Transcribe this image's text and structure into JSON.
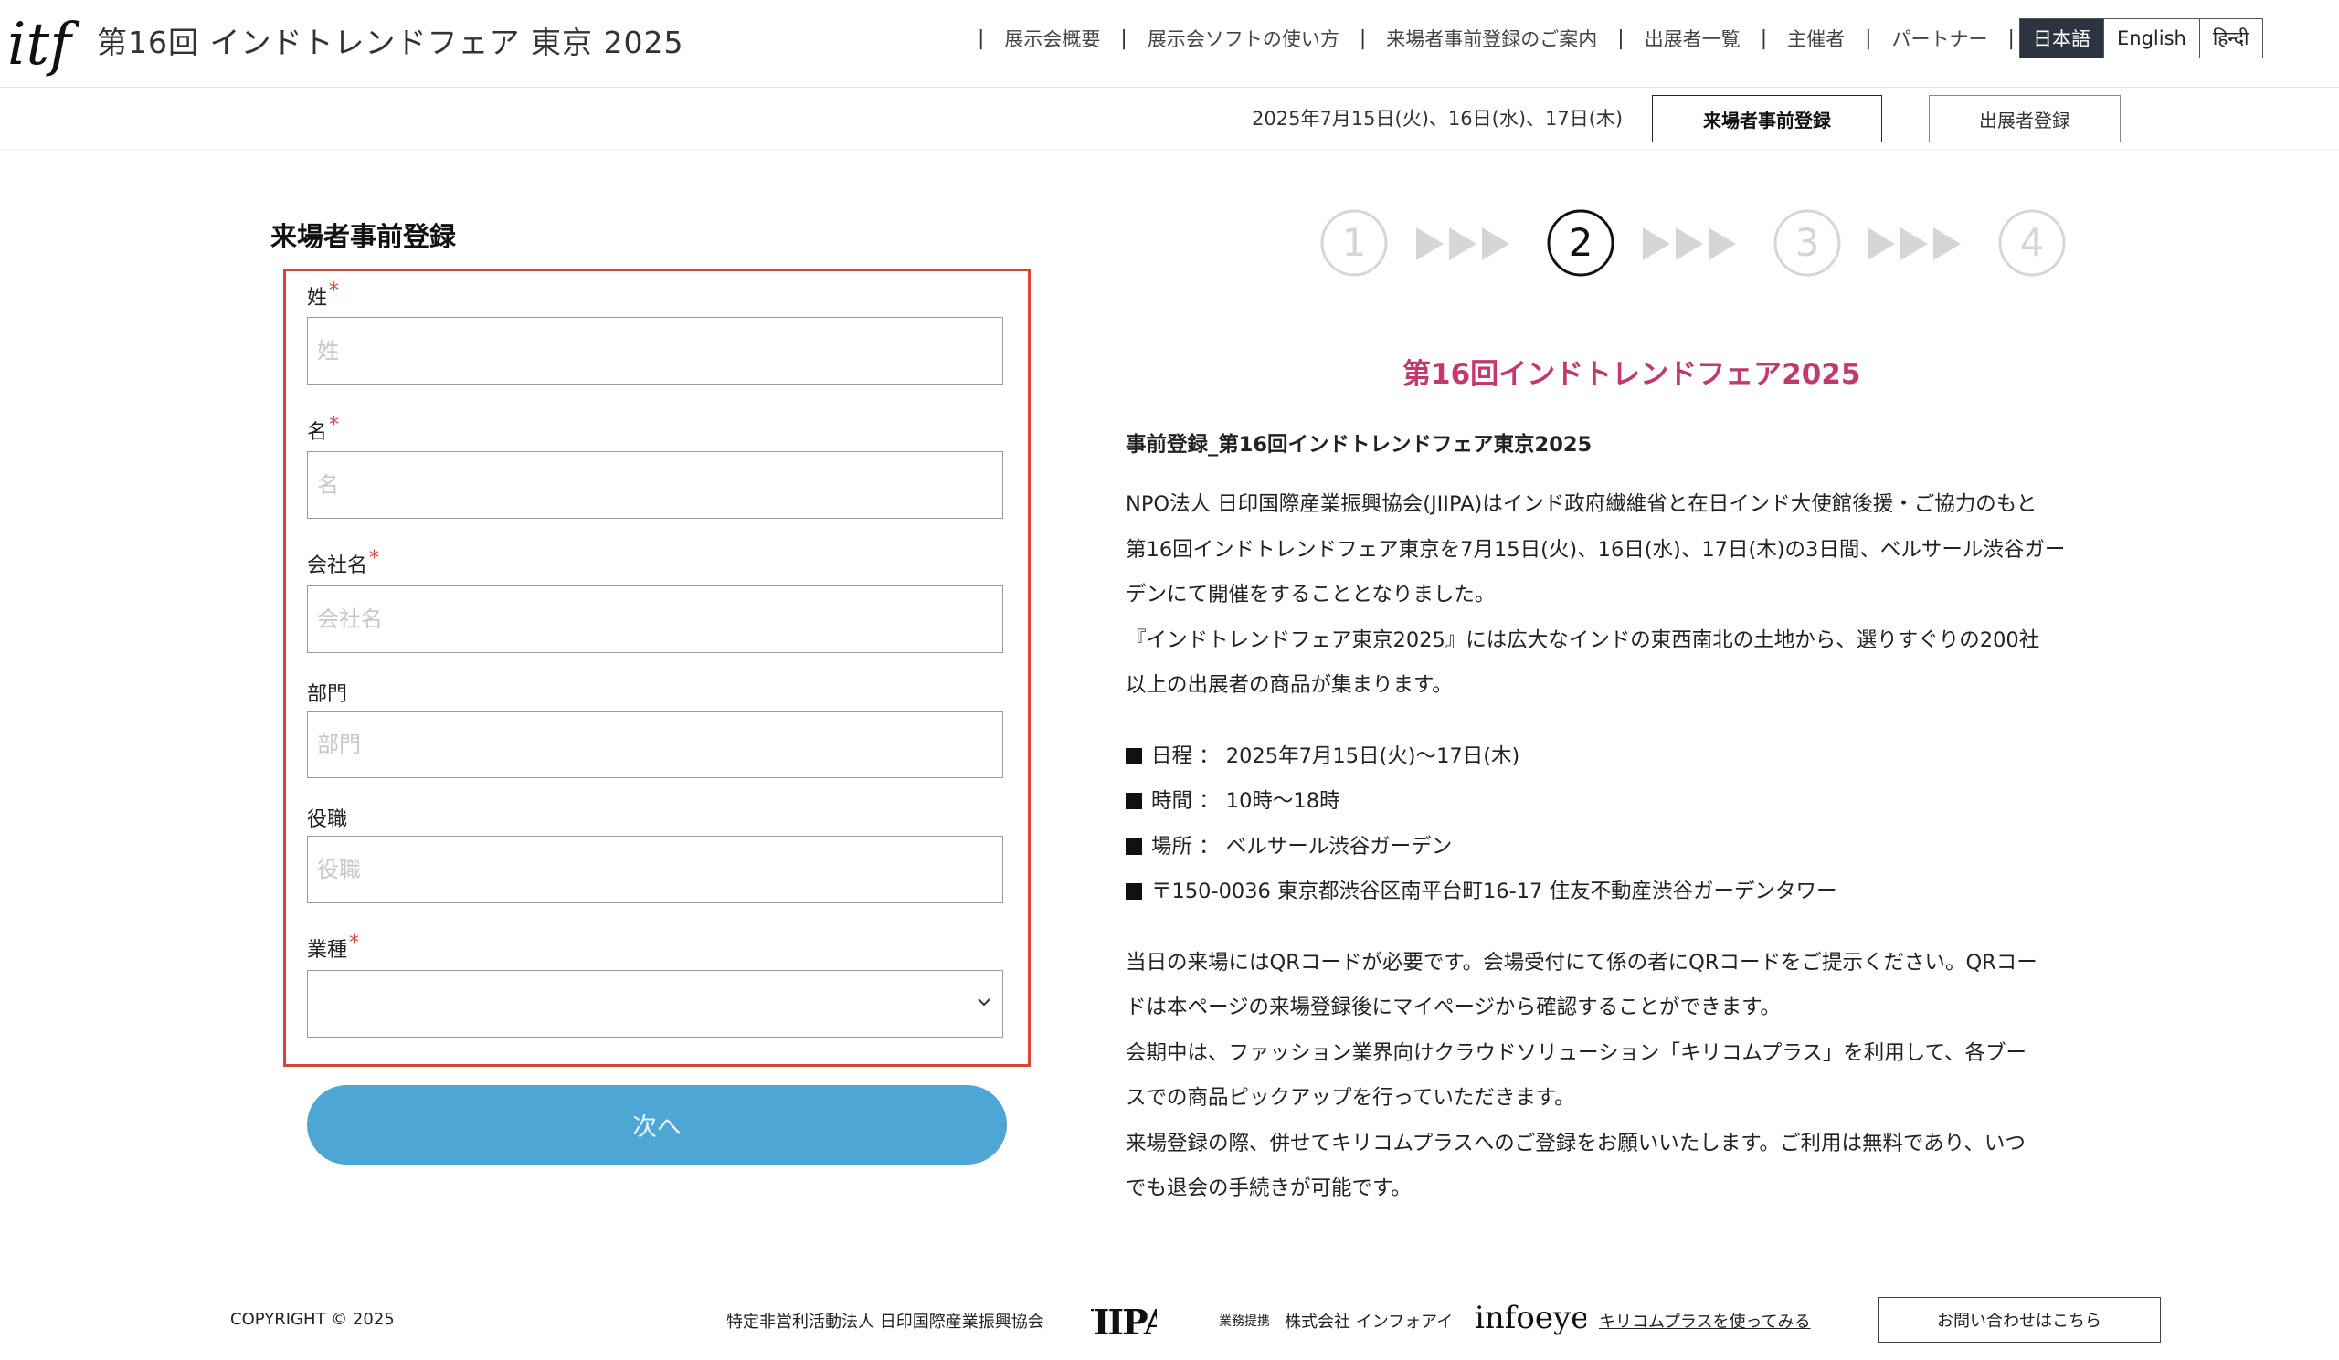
{
  "header": {
    "logo_text": "itf",
    "title": "第16回 インドトレンドフェア 東京 2025",
    "nav": [
      {
        "label": "展示会概要"
      },
      {
        "label": "展示会ソフトの使い方"
      },
      {
        "label": "来場者事前登録のご案内"
      },
      {
        "label": "出展者一覧"
      },
      {
        "label": "主催者"
      },
      {
        "label": "パートナー"
      }
    ],
    "languages": [
      {
        "label": "日本語",
        "active": true
      },
      {
        "label": "English",
        "active": false
      },
      {
        "label": "हिन्दी",
        "active": false
      }
    ]
  },
  "subbar": {
    "dates": "2025年7月15日(火)、16日(水)、17日(木)",
    "visitor_button": "来場者事前登録",
    "exhibitor_button": "出展者登録"
  },
  "form": {
    "title": "来場者事前登録",
    "required_mark": "*",
    "fields": [
      {
        "label": "姓",
        "placeholder": "姓",
        "required": true,
        "value": ""
      },
      {
        "label": "名",
        "placeholder": "名",
        "required": true,
        "value": ""
      },
      {
        "label": "会社名",
        "placeholder": "会社名",
        "required": true,
        "value": ""
      },
      {
        "label": "部門",
        "placeholder": "部門",
        "required": false,
        "value": ""
      },
      {
        "label": "役職",
        "placeholder": "役職",
        "required": false,
        "value": ""
      }
    ],
    "industry": {
      "label": "業種",
      "required": true,
      "selected": ""
    },
    "next_button": "次へ"
  },
  "steps": {
    "items": [
      "1",
      "2",
      "3",
      "4"
    ],
    "current": 2,
    "active_color": "#111111",
    "inactive_color": "#d6d6d6"
  },
  "info": {
    "heading": "第16回インドトレンドフェア2025",
    "heading_color": "#c23a6d",
    "lead": "事前登録_第16回インドトレンドフェア東京2025",
    "intro_lines": [
      "NPO法人 日印国際産業振興協会(JIIPA)はインド政府繊維省と在日インド大使館後援・ご協力のもと",
      "第16回インドトレンドフェア東京を7月15日(火)、16日(水)、17日(木)の3日間、ベルサール渋谷ガー",
      "デンにて開催をすることとなりました。",
      "『インドトレンドフェア東京2025』には広大なインドの東西南北の土地から、選りすぐりの200社",
      "以上の出展者の商品が集まります。"
    ],
    "bullets": [
      "日程 ： 2025年7月15日(火)〜17日(木)",
      "時間 ： 10時〜18時",
      "場所 ： ベルサール渋谷ガーデン",
      "〒150-0036 東京都渋谷区南平台町16-17 住友不動産渋谷ガーデンタワー"
    ],
    "notes": [
      "当日の来場にはQRコードが必要です。会場受付にて係の者にQRコードをご提示ください。QRコー",
      "ドは本ページの来場登録後にマイページから確認することができます。",
      "会期中は、ファッション業界向けクラウドソリューション「キリコムプラス」を利用して、各ブー",
      "スでの商品ピックアップを行っていただきます。",
      "来場登録の際、併せてキリコムプラスへのご登録をお願いいたします。ご利用は無料であり、いつ",
      "でも退会の手続きが可能です。"
    ]
  },
  "footer": {
    "copyright": "COPYRIGHT © 2025",
    "organizer": "特定非営利活動法人 日印国際産業振興協会",
    "jiipa_logo": "JIIPA",
    "support_label": "業務提携",
    "company": "株式会社 インフォアイ",
    "infoeye_logo": "infoeye",
    "kiricom_link": "キリコムプラスを使ってみる",
    "contact_button": "お問い合わせはこちら"
  }
}
